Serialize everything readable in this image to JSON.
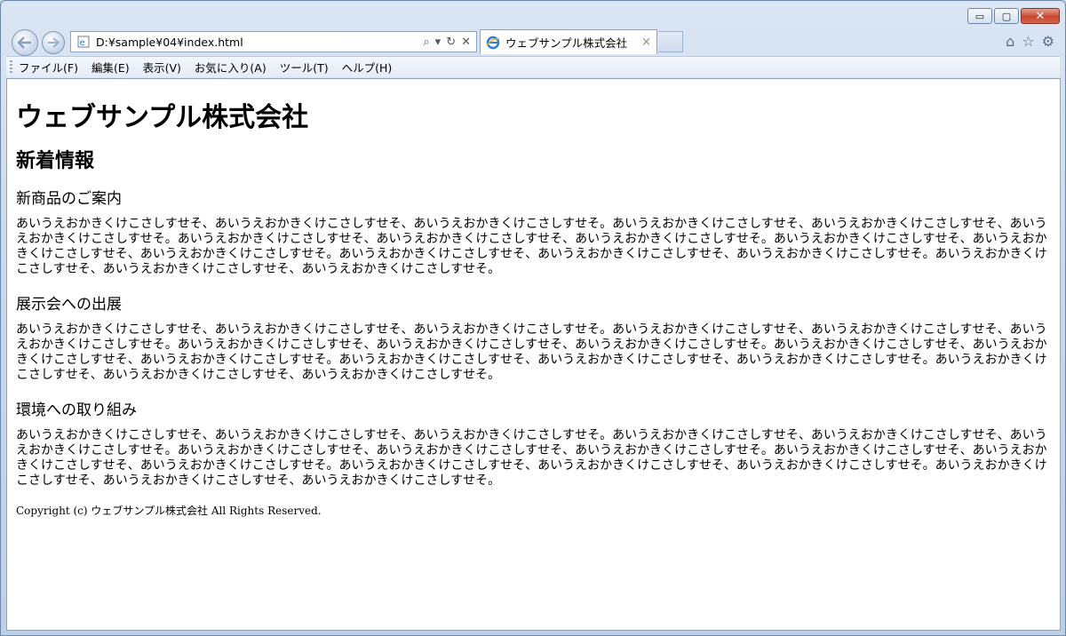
{
  "window": {
    "caption_buttons": {
      "minimize": "▭",
      "maximize": "▢",
      "close": "✕"
    }
  },
  "navigation": {
    "back_icon": "arrow-left-icon",
    "forward_icon": "arrow-right-icon",
    "address": "D:¥sample¥04¥index.html",
    "address_tools": {
      "search": "⌕",
      "dropdown": "▾",
      "refresh": "↻",
      "stop": "✕"
    },
    "tab": {
      "title": "ウェブサンプル株式会社",
      "close": "×"
    },
    "right_icons": {
      "home": "⌂",
      "favorites": "☆",
      "tools": "⚙"
    }
  },
  "menubar": [
    {
      "label": "ファイル(F)"
    },
    {
      "label": "編集(E)"
    },
    {
      "label": "表示(V)"
    },
    {
      "label": "お気に入り(A)"
    },
    {
      "label": "ツール(T)"
    },
    {
      "label": "ヘルプ(H)"
    }
  ],
  "page": {
    "title": "ウェブサンプル株式会社",
    "section_heading": "新着情報",
    "articles": [
      {
        "heading": "新商品のご案内",
        "body": "あいうえおかきくけこさしすせそ、あいうえおかきくけこさしすせそ、あいうえおかきくけこさしすせそ。あいうえおかきくけこさしすせそ、あいうえおかきくけこさしすせそ、あいうえおかきくけこさしすせそ。あいうえおかきくけこさしすせそ、あいうえおかきくけこさしすせそ、あいうえおかきくけこさしすせそ。あいうえおかきくけこさしすせそ、あいうえおかきくけこさしすせそ、あいうえおかきくけこさしすせそ。あいうえおかきくけこさしすせそ、あいうえおかきくけこさしすせそ、あいうえおかきくけこさしすせそ。あいうえおかきくけこさしすせそ、あいうえおかきくけこさしすせそ、あいうえおかきくけこさしすせそ。"
      },
      {
        "heading": "展示会への出展",
        "body": "あいうえおかきくけこさしすせそ、あいうえおかきくけこさしすせそ、あいうえおかきくけこさしすせそ。あいうえおかきくけこさしすせそ、あいうえおかきくけこさしすせそ、あいうえおかきくけこさしすせそ。あいうえおかきくけこさしすせそ、あいうえおかきくけこさしすせそ、あいうえおかきくけこさしすせそ。あいうえおかきくけこさしすせそ、あいうえおかきくけこさしすせそ、あいうえおかきくけこさしすせそ。あいうえおかきくけこさしすせそ、あいうえおかきくけこさしすせそ、あいうえおかきくけこさしすせそ。あいうえおかきくけこさしすせそ、あいうえおかきくけこさしすせそ、あいうえおかきくけこさしすせそ。"
      },
      {
        "heading": "環境への取り組み",
        "body": "あいうえおかきくけこさしすせそ、あいうえおかきくけこさしすせそ、あいうえおかきくけこさしすせそ。あいうえおかきくけこさしすせそ、あいうえおかきくけこさしすせそ、あいうえおかきくけこさしすせそ。あいうえおかきくけこさしすせそ、あいうえおかきくけこさしすせそ、あいうえおかきくけこさしすせそ。あいうえおかきくけこさしすせそ、あいうえおかきくけこさしすせそ、あいうえおかきくけこさしすせそ。あいうえおかきくけこさしすせそ、あいうえおかきくけこさしすせそ、あいうえおかきくけこさしすせそ。あいうえおかきくけこさしすせそ、あいうえおかきくけこさしすせそ、あいうえおかきくけこさしすせそ。"
      }
    ],
    "footer": "Copyright (c) ウェブサンプル株式会社 All Rights Reserved."
  }
}
